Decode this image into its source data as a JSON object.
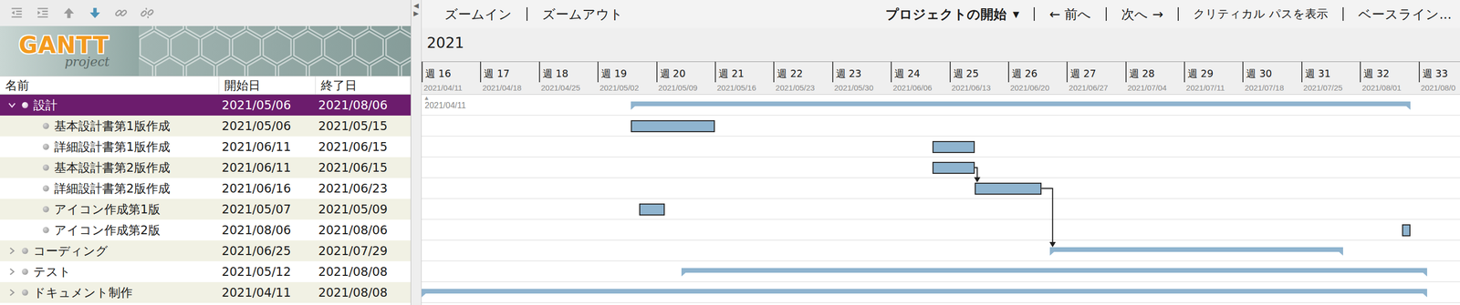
{
  "left_toolbar": [
    {
      "kind": "outdent",
      "disabled": true
    },
    {
      "kind": "indent",
      "disabled": true
    },
    {
      "kind": "up",
      "disabled": true
    },
    {
      "kind": "down",
      "disabled": false
    },
    {
      "kind": "link",
      "disabled": true
    },
    {
      "kind": "unlink",
      "disabled": true
    }
  ],
  "logo": {
    "title": "GANTT",
    "subtitle": "project"
  },
  "splitter": [
    "◀",
    "▶"
  ],
  "table": {
    "columns": [
      "名前",
      "開始日",
      "終了日"
    ]
  },
  "tasks": [
    {
      "name": "設計",
      "start": "2021/05/06",
      "end": "2021/08/06",
      "kind": "summary",
      "expanded": true,
      "selected": true,
      "children": [
        {
          "name": "基本設計書第1版作成",
          "start": "2021/05/06",
          "end": "2021/05/15",
          "kind": "task",
          "selected": false
        },
        {
          "name": "詳細設計書第1版作成",
          "start": "2021/06/11",
          "end": "2021/06/15",
          "kind": "task",
          "selected": false
        },
        {
          "name": "基本設計書第2版作成",
          "start": "2021/06/11",
          "end": "2021/06/15",
          "kind": "task",
          "selected": false
        },
        {
          "name": "詳細設計書第2版作成",
          "start": "2021/06/16",
          "end": "2021/06/23",
          "kind": "task",
          "selected": false
        },
        {
          "name": "アイコン作成第1版",
          "start": "2021/05/07",
          "end": "2021/05/09",
          "kind": "task",
          "selected": false
        },
        {
          "name": "アイコン作成第2版",
          "start": "2021/08/06",
          "end": "2021/08/06",
          "kind": "task",
          "selected": false
        }
      ]
    },
    {
      "name": "コーディング",
      "start": "2021/06/25",
      "end": "2021/07/29",
      "kind": "summary",
      "expanded": false,
      "selected": false
    },
    {
      "name": "テスト",
      "start": "2021/05/12",
      "end": "2021/08/08",
      "kind": "summary",
      "expanded": false,
      "selected": false
    },
    {
      "name": "ドキュメント制作",
      "start": "2021/04/11",
      "end": "2021/08/08",
      "kind": "summary",
      "expanded": false,
      "selected": false
    }
  ],
  "chart_toolbar": {
    "zoom_in": "ズームイン",
    "zoom_out": "ズームアウト",
    "project_start": {
      "label": "プロジェクトの開始",
      "icon": "▼"
    },
    "prev": "← 前へ",
    "next": "次へ →",
    "critical_path": "クリティカル パスを表示",
    "baseline": "ベースライン..."
  },
  "year": "2021",
  "weeks": [
    {
      "label": "週 16",
      "date": "2021/04/11"
    },
    {
      "label": "週 17",
      "date": "2021/04/18"
    },
    {
      "label": "週 18",
      "date": "2021/04/25"
    },
    {
      "label": "週 19",
      "date": "2021/05/02"
    },
    {
      "label": "週 20",
      "date": "2021/05/09"
    },
    {
      "label": "週 21",
      "date": "2021/05/16"
    },
    {
      "label": "週 22",
      "date": "2021/05/23"
    },
    {
      "label": "週 23",
      "date": "2021/05/30"
    },
    {
      "label": "週 24",
      "date": "2021/06/06"
    },
    {
      "label": "週 25",
      "date": "2021/06/13"
    },
    {
      "label": "週 26",
      "date": "2021/06/20"
    },
    {
      "label": "週 27",
      "date": "2021/06/27"
    },
    {
      "label": "週 28",
      "date": "2021/07/04"
    },
    {
      "label": "週 29",
      "date": "2021/07/11"
    },
    {
      "label": "週 30",
      "date": "2021/07/18"
    },
    {
      "label": "週 31",
      "date": "2021/07/25"
    },
    {
      "label": "週 32",
      "date": "2021/08/01"
    },
    {
      "label": "週 33",
      "date": "2021/08/0"
    }
  ],
  "project_start_marker": {
    "icon": "▲",
    "date": "2021/04/11"
  },
  "dependencies": [
    {
      "from": "基本設計書第2版作成",
      "to": "詳細設計書第2版作成"
    },
    {
      "from": "詳細設計書第2版作成",
      "to": "コーディング"
    }
  ]
}
